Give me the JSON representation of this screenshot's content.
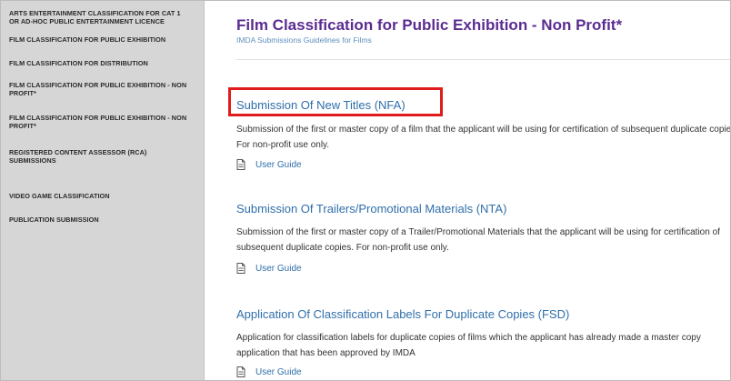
{
  "sidebar": {
    "items": [
      {
        "label": "ARTS ENTERTAINMENT CLASSIFICATION FOR CAT 1 OR AD-HOC PUBLIC ENTERTAINMENT LICENCE"
      },
      {
        "label": "FILM CLASSIFICATION FOR PUBLIC EXHIBITION"
      },
      {
        "label": "FILM CLASSIFICATION FOR DISTRIBUTION"
      },
      {
        "label": "FILM CLASSIFICATION FOR PUBLIC EXHIBITION - NON PROFIT*"
      },
      {
        "label": "FILM CLASSIFICATION FOR PUBLIC EXHIBITION - NON PROFIT*"
      },
      {
        "label": "REGISTERED CONTENT ASSESSOR (RCA) SUBMISSIONS"
      },
      {
        "label": "VIDEO GAME CLASSIFICATION"
      },
      {
        "label": "PUBLICATION SUBMISSION"
      }
    ]
  },
  "header": {
    "title": "Film Classification for Public Exhibition - Non Profit*",
    "subtitle": "IMDA Submissions Guidelines for Films"
  },
  "sections": [
    {
      "title": "Submission Of New Titles (NFA)",
      "description": "Submission of the first or master copy of a film that the applicant will be using for certification of subsequent duplicate copies. For non-profit use only.",
      "guide_label": "User Guide"
    },
    {
      "title": "Submission Of Trailers/Promotional Materials (NTA)",
      "description": "Submission of the first or master copy of a Trailer/Promotional Materials that the applicant will be using for certification of subsequent duplicate copies. For non-profit use only.",
      "guide_label": "User Guide"
    },
    {
      "title": "Application Of Classification Labels For Duplicate Copies (FSD)",
      "description": "Application for classification labels for duplicate copies of films which the applicant has already made a master copy application that has been approved by IMDA",
      "guide_label": "User Guide"
    }
  ],
  "colors": {
    "title": "#5b2c91",
    "link": "#2f6fab",
    "highlight": "#e01d1d",
    "sidebar_bg": "#d6d6d6"
  },
  "icons": {
    "guide": "document-icon"
  }
}
